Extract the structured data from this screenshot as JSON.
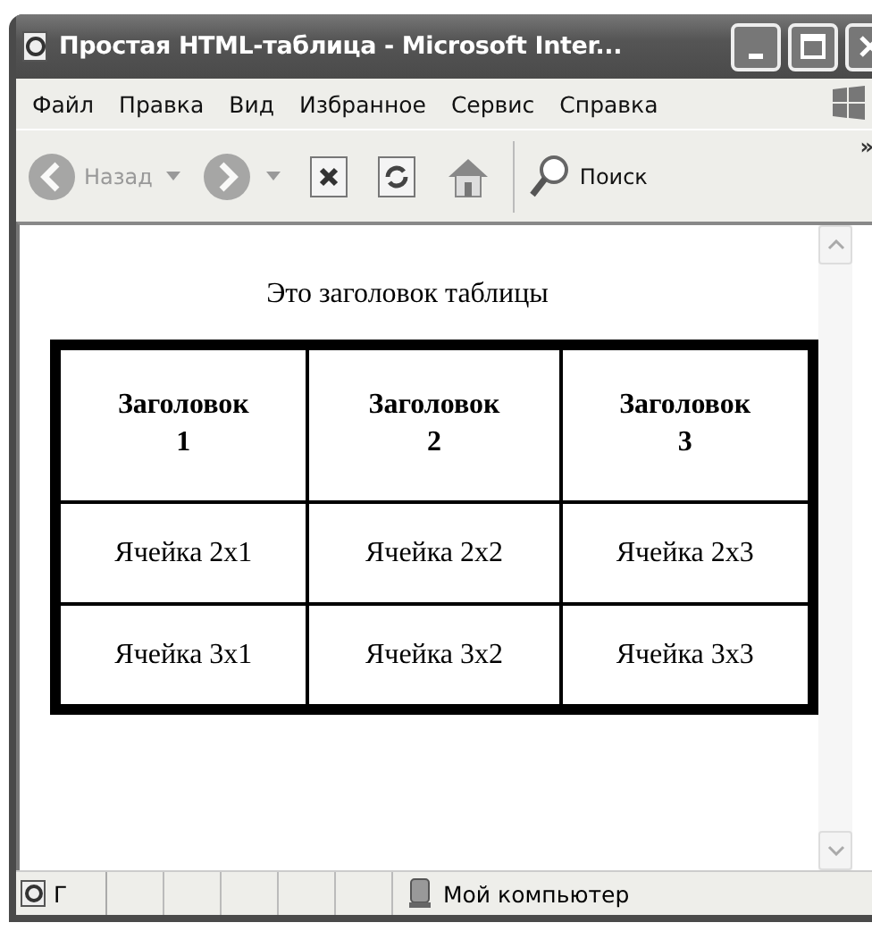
{
  "window": {
    "title": "Простая HTML-таблица - Microsoft Inter..."
  },
  "menu": [
    {
      "label": "Файл"
    },
    {
      "label": "Правка"
    },
    {
      "label": "Вид"
    },
    {
      "label": "Избранное"
    },
    {
      "label": "Сервис"
    },
    {
      "label": "Справка"
    }
  ],
  "toolbar": {
    "back": {
      "label": "Назад",
      "disabled": true
    },
    "forward": {
      "disabled": true
    },
    "search": {
      "label": "Поиск"
    },
    "more": "»"
  },
  "page": {
    "caption": "Это заголовок таблицы",
    "table": {
      "columns": [
        "Заголовок 1",
        "Заголовок 2",
        "Заголовок 3"
      ],
      "rows": [
        [
          "Ячейка 2x1",
          "Ячейка 2x2",
          "Ячейка 2x3"
        ],
        [
          "Ячейка 3x1",
          "Ячейка 3x2",
          "Ячейка 3x3"
        ]
      ]
    }
  },
  "status_bar": {
    "text": "Г",
    "zone": "Мой компьютер"
  }
}
